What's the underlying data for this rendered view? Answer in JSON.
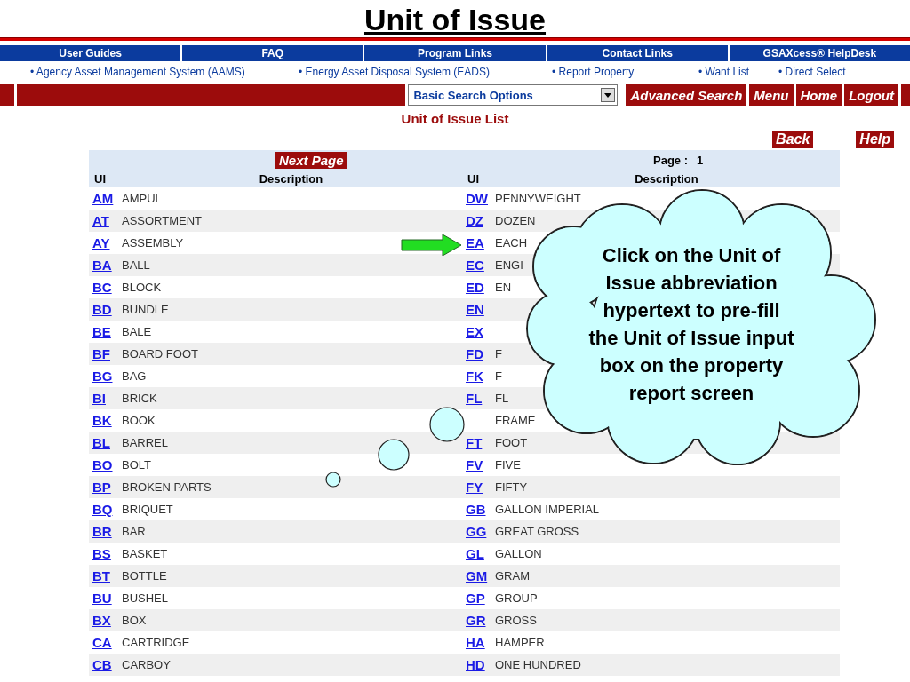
{
  "slide_title": "Unit of Issue",
  "nav_bar": [
    "User Guides",
    "FAQ",
    "Program Links",
    "Contact Links",
    "GSAXcess® HelpDesk"
  ],
  "sub_links": [
    "• Agency Asset Management System (AAMS)",
    "• Energy Asset Disposal System (EADS)",
    "• Report Property",
    "• Want List",
    "• Direct Select"
  ],
  "action_bar": {
    "search_select": "Basic Search Options",
    "buttons": [
      "Advanced Search",
      "Menu",
      "Home",
      "Logout"
    ]
  },
  "page_title": "Unit of Issue List",
  "page_buttons": [
    "Back",
    "Help"
  ],
  "table": {
    "next_page": "Next Page",
    "page_label": "Page :",
    "page_number": "1",
    "columns": [
      "UI",
      "Description",
      "UI",
      "Description"
    ],
    "left_rows": [
      {
        "code": "AM",
        "description": "AMPUL"
      },
      {
        "code": "AT",
        "description": "ASSORTMENT"
      },
      {
        "code": "AY",
        "description": "ASSEMBLY"
      },
      {
        "code": "BA",
        "description": "BALL"
      },
      {
        "code": "BC",
        "description": "BLOCK"
      },
      {
        "code": "BD",
        "description": "BUNDLE"
      },
      {
        "code": "BE",
        "description": "BALE"
      },
      {
        "code": "BF",
        "description": "BOARD FOOT"
      },
      {
        "code": "BG",
        "description": "BAG"
      },
      {
        "code": "BI",
        "description": "BRICK"
      },
      {
        "code": "BK",
        "description": "BOOK"
      },
      {
        "code": "BL",
        "description": "BARREL"
      },
      {
        "code": "BO",
        "description": "BOLT"
      },
      {
        "code": "BP",
        "description": "BROKEN PARTS"
      },
      {
        "code": "BQ",
        "description": "BRIQUET"
      },
      {
        "code": "BR",
        "description": "BAR"
      },
      {
        "code": "BS",
        "description": "BASKET"
      },
      {
        "code": "BT",
        "description": "BOTTLE"
      },
      {
        "code": "BU",
        "description": "BUSHEL"
      },
      {
        "code": "BX",
        "description": "BOX"
      },
      {
        "code": "CA",
        "description": "CARTRIDGE"
      },
      {
        "code": "CB",
        "description": "CARBOY"
      }
    ],
    "right_rows": [
      {
        "code": "DW",
        "description": "PENNYWEIGHT"
      },
      {
        "code": "DZ",
        "description": "DOZEN"
      },
      {
        "code": "EA",
        "description": "EACH"
      },
      {
        "code": "EC",
        "description": "ENGI"
      },
      {
        "code": "ED",
        "description": "EN"
      },
      {
        "code": "EN"
      },
      {
        "code": "EX"
      },
      {
        "code": "FD",
        "description": "F"
      },
      {
        "code": "FK",
        "description": "F"
      },
      {
        "code": "FL",
        "description": "FL"
      },
      {
        "description": "FRAME"
      },
      {
        "code": "FT",
        "description": "FOOT"
      },
      {
        "code": "FV",
        "description": "FIVE"
      },
      {
        "code": "FY",
        "description": "FIFTY"
      },
      {
        "code": "GB",
        "description": "GALLON IMPERIAL"
      },
      {
        "code": "GG",
        "description": "GREAT GROSS"
      },
      {
        "code": "GL",
        "description": "GALLON"
      },
      {
        "code": "GM",
        "description": "GRAM"
      },
      {
        "code": "GP",
        "description": "GROUP"
      },
      {
        "code": "GR",
        "description": "GROSS"
      },
      {
        "code": "HA",
        "description": "HAMPER"
      },
      {
        "code": "HD",
        "description": "ONE HUNDRED"
      }
    ]
  },
  "callout": {
    "text": "Click on the Unit of Issue abbreviation hypertext to pre-fill the Unit of Issue input box on the property report screen"
  }
}
